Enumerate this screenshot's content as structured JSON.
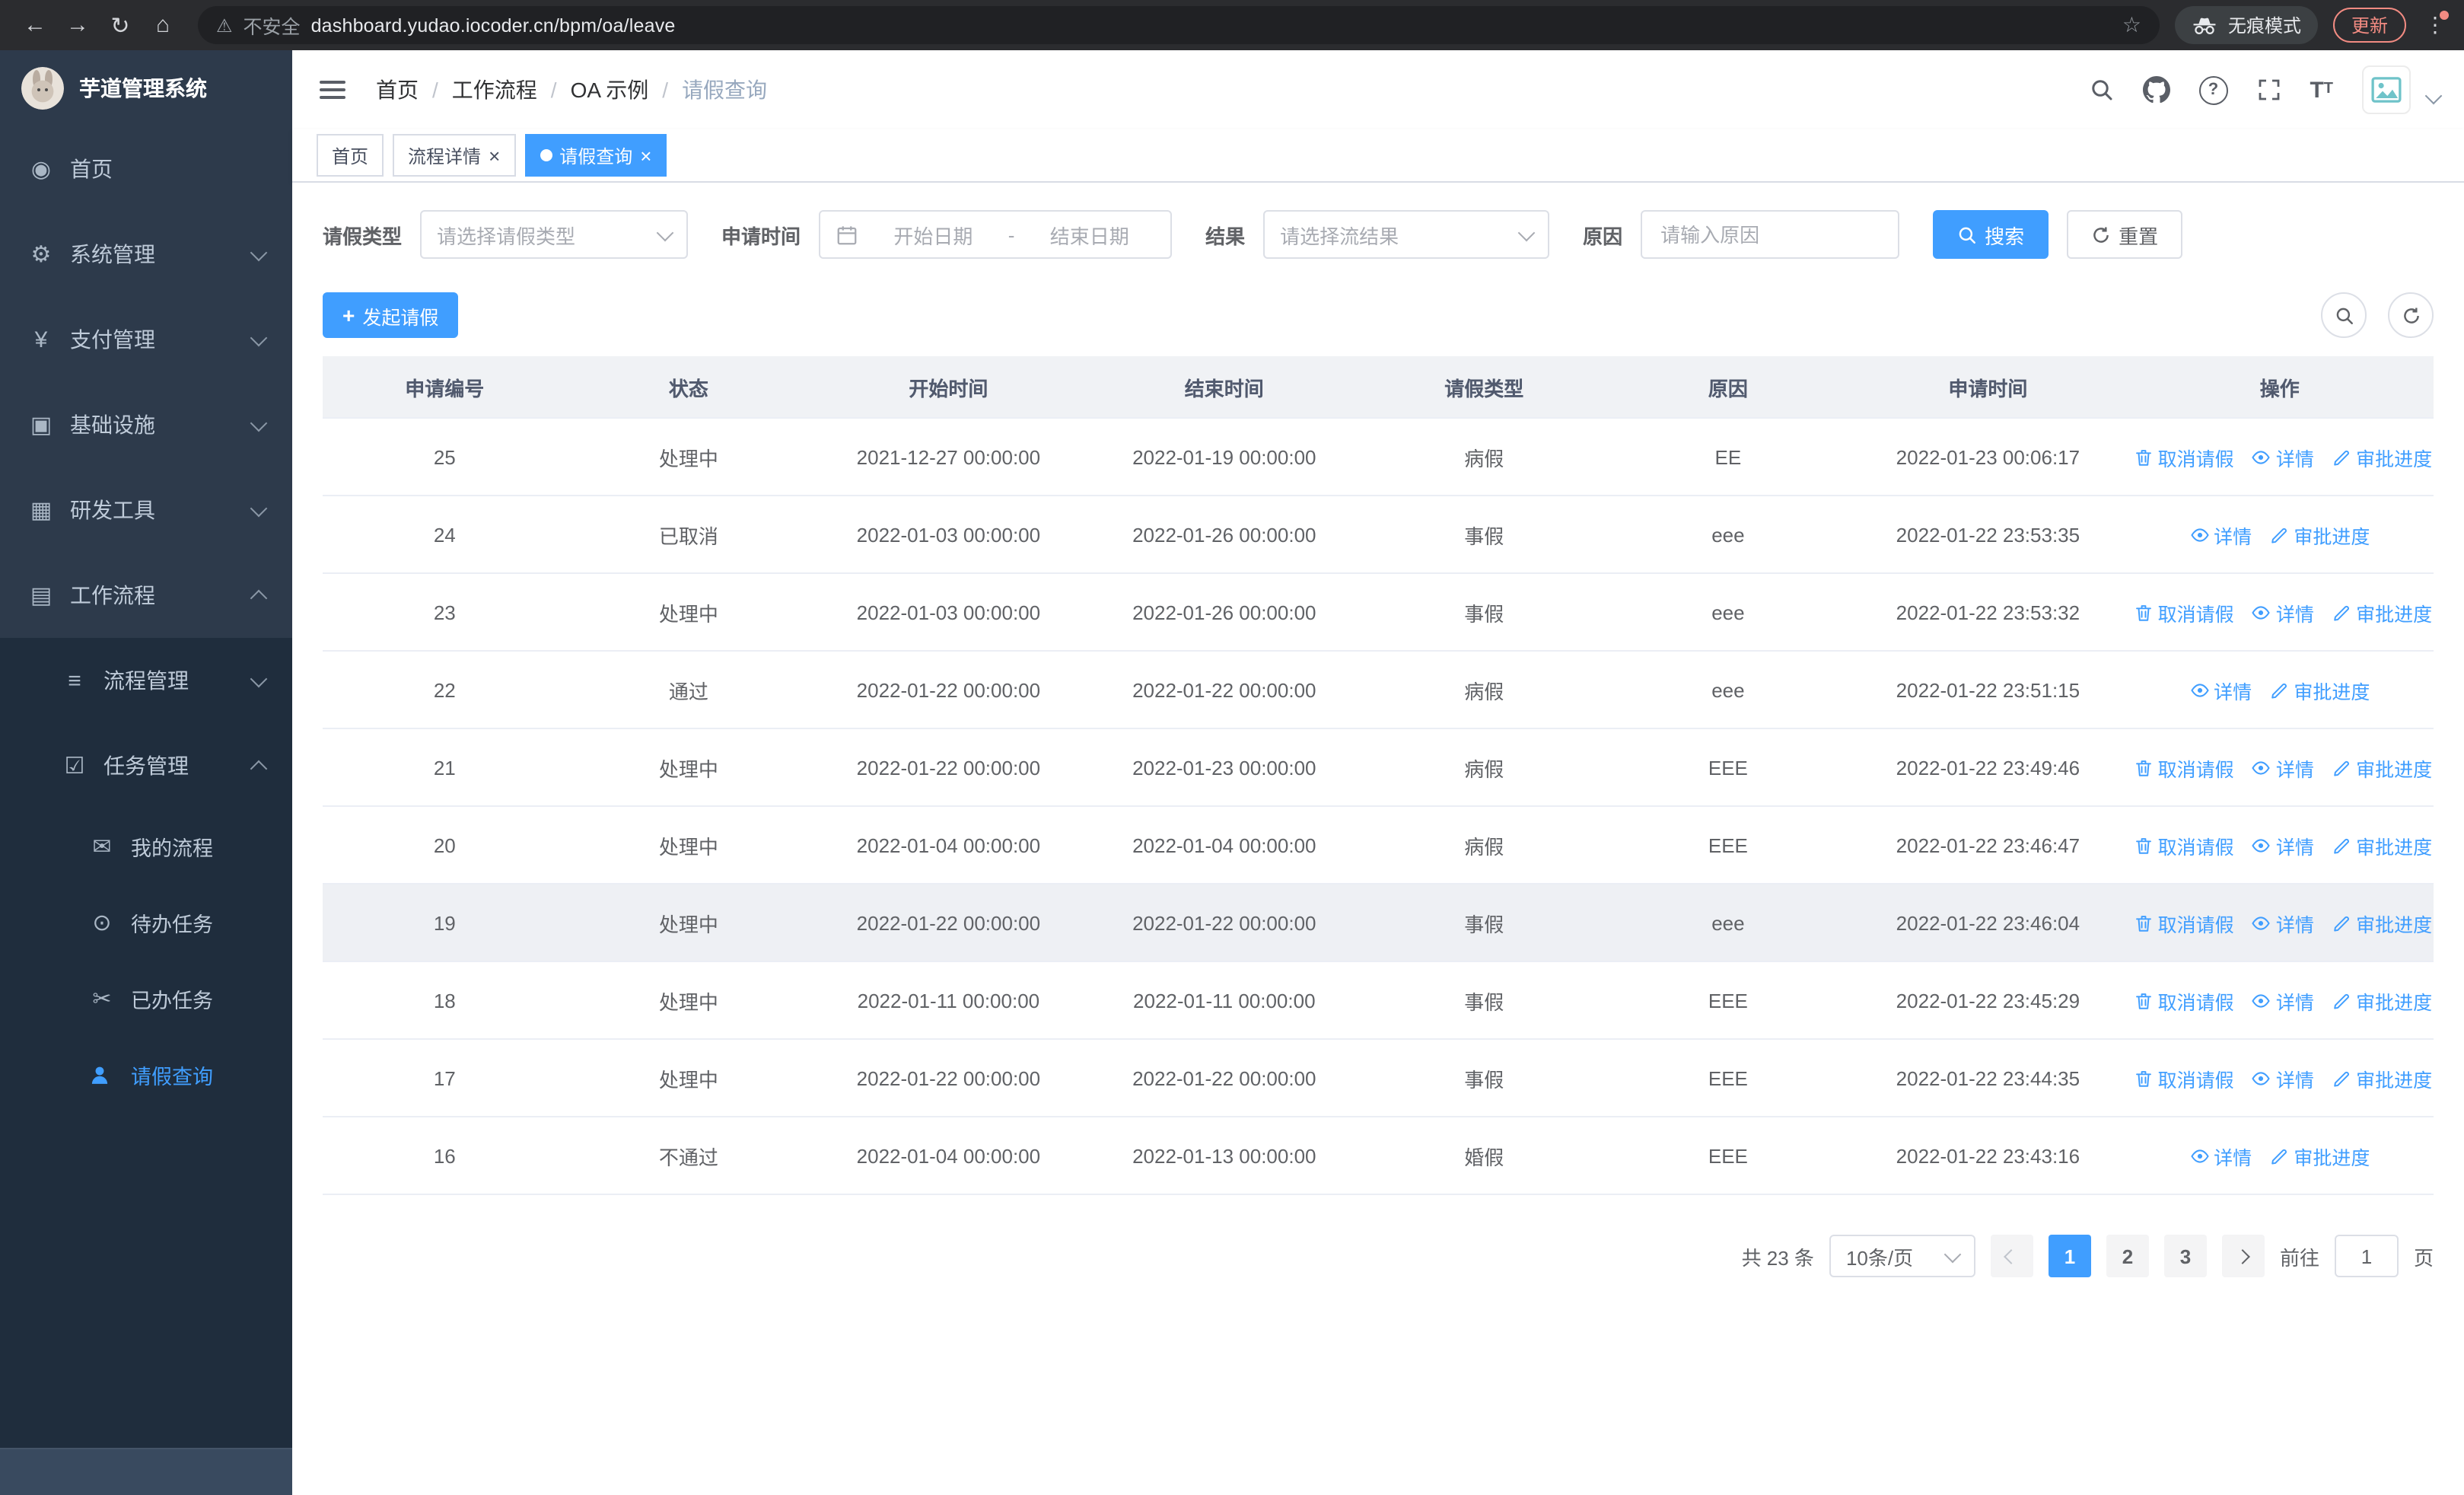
{
  "browser": {
    "url": "dashboard.yudao.iocoder.cn/bpm/oa/leave",
    "security_label": "不安全",
    "incognito_label": "无痕模式",
    "update_label": "更新"
  },
  "glyphs": {
    "back": "←",
    "forward": "→",
    "reload": "↻",
    "home": "⌂",
    "warning": "⚠",
    "star": "☆",
    "menu_dots": "⋮",
    "plus": "+",
    "question": "?",
    "font_big": "T",
    "font_small": "T"
  },
  "sidebar": {
    "logo_title": "芋道管理系统",
    "items": [
      {
        "label": "首页",
        "icon": "dashboard-icon",
        "glyph": "◉"
      },
      {
        "label": "系统管理",
        "icon": "gear-icon",
        "glyph": "⚙"
      },
      {
        "label": "支付管理",
        "icon": "yen-icon",
        "glyph": "¥"
      },
      {
        "label": "基础设施",
        "icon": "infrastructure-icon",
        "glyph": "▣"
      },
      {
        "label": "研发工具",
        "icon": "toolbox-icon",
        "glyph": "▦"
      },
      {
        "label": "工作流程",
        "icon": "workflow-icon",
        "glyph": "▤"
      }
    ],
    "sub_items": [
      {
        "label": "流程管理",
        "icon": "process-icon",
        "glyph": "≡"
      },
      {
        "label": "任务管理",
        "icon": "task-icon",
        "glyph": "☑"
      }
    ],
    "leaf_items": [
      {
        "label": "我的流程",
        "icon": "message-icon",
        "glyph": "✉"
      },
      {
        "label": "待办任务",
        "icon": "eye-icon",
        "glyph": "⊙"
      },
      {
        "label": "已办任务",
        "icon": "scissors-icon",
        "glyph": "✂"
      },
      {
        "label": "请假查询",
        "icon": "user-icon",
        "glyph": "",
        "active": true
      }
    ]
  },
  "navbar": {
    "breadcrumb": [
      "首页",
      "工作流程",
      "OA 示例",
      "请假查询"
    ]
  },
  "tabs": [
    {
      "label": "首页",
      "closable": false,
      "active": false
    },
    {
      "label": "流程详情",
      "closable": true,
      "active": false
    },
    {
      "label": "请假查询",
      "closable": true,
      "active": true
    }
  ],
  "filters": {
    "leave_type_label": "请假类型",
    "leave_type_placeholder": "请选择请假类型",
    "apply_time_label": "申请时间",
    "start_date_placeholder": "开始日期",
    "date_separator": "-",
    "end_date_placeholder": "结束日期",
    "result_label": "结果",
    "result_placeholder": "请选择流结果",
    "reason_label": "原因",
    "reason_placeholder": "请输入原因",
    "search_label": "搜索",
    "reset_label": "重置"
  },
  "toolbar": {
    "create_label": "发起请假"
  },
  "table": {
    "columns": [
      "申请编号",
      "状态",
      "开始时间",
      "结束时间",
      "请假类型",
      "原因",
      "申请时间",
      "操作"
    ],
    "actions": {
      "cancel": "取消请假",
      "detail": "详情",
      "progress": "审批进度"
    },
    "rows": [
      {
        "id": "25",
        "status": "处理中",
        "start": "2021-12-27 00:00:00",
        "end": "2022-01-19 00:00:00",
        "type": "病假",
        "reason": "EE",
        "applied": "2022-01-23 00:06:17",
        "can_cancel": true
      },
      {
        "id": "24",
        "status": "已取消",
        "start": "2022-01-03 00:00:00",
        "end": "2022-01-26 00:00:00",
        "type": "事假",
        "reason": "eee",
        "applied": "2022-01-22 23:53:35",
        "can_cancel": false
      },
      {
        "id": "23",
        "status": "处理中",
        "start": "2022-01-03 00:00:00",
        "end": "2022-01-26 00:00:00",
        "type": "事假",
        "reason": "eee",
        "applied": "2022-01-22 23:53:32",
        "can_cancel": true
      },
      {
        "id": "22",
        "status": "通过",
        "start": "2022-01-22 00:00:00",
        "end": "2022-01-22 00:00:00",
        "type": "病假",
        "reason": "eee",
        "applied": "2022-01-22 23:51:15",
        "can_cancel": false
      },
      {
        "id": "21",
        "status": "处理中",
        "start": "2022-01-22 00:00:00",
        "end": "2022-01-23 00:00:00",
        "type": "病假",
        "reason": "EEE",
        "applied": "2022-01-22 23:49:46",
        "can_cancel": true
      },
      {
        "id": "20",
        "status": "处理中",
        "start": "2022-01-04 00:00:00",
        "end": "2022-01-04 00:00:00",
        "type": "病假",
        "reason": "EEE",
        "applied": "2022-01-22 23:46:47",
        "can_cancel": true
      },
      {
        "id": "19",
        "status": "处理中",
        "start": "2022-01-22 00:00:00",
        "end": "2022-01-22 00:00:00",
        "type": "事假",
        "reason": "eee",
        "applied": "2022-01-22 23:46:04",
        "can_cancel": true,
        "hover": true
      },
      {
        "id": "18",
        "status": "处理中",
        "start": "2022-01-11 00:00:00",
        "end": "2022-01-11 00:00:00",
        "type": "事假",
        "reason": "EEE",
        "applied": "2022-01-22 23:45:29",
        "can_cancel": true
      },
      {
        "id": "17",
        "status": "处理中",
        "start": "2022-01-22 00:00:00",
        "end": "2022-01-22 00:00:00",
        "type": "事假",
        "reason": "EEE",
        "applied": "2022-01-22 23:44:35",
        "can_cancel": true
      },
      {
        "id": "16",
        "status": "不通过",
        "start": "2022-01-04 00:00:00",
        "end": "2022-01-13 00:00:00",
        "type": "婚假",
        "reason": "EEE",
        "applied": "2022-01-22 23:43:16",
        "can_cancel": false
      }
    ]
  },
  "pagination": {
    "total_label": "共 23 条",
    "page_size": "10条/页",
    "pages": [
      "1",
      "2",
      "3"
    ],
    "active_page": "1",
    "goto_label": "前往",
    "goto_value": "1",
    "page_unit": "页"
  },
  "colors": {
    "accent": "#409eff",
    "sidebar_bg": "#2d3a4b",
    "submenu_bg": "#1f2d3d",
    "table_header_bg": "#f0f2f5",
    "update_red": "#f28b82"
  }
}
